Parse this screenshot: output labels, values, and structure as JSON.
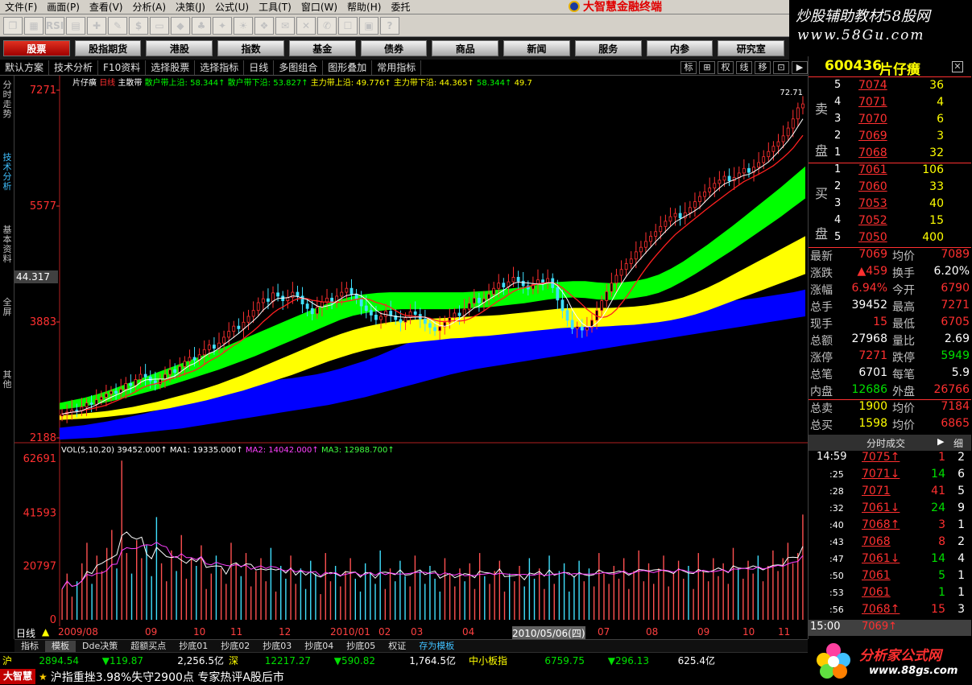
{
  "menu": [
    "文件(F)",
    "画面(P)",
    "查看(V)",
    "分析(A)",
    "决策(J)",
    "公式(U)",
    "工具(T)",
    "窗口(W)",
    "帮助(H)",
    "委托"
  ],
  "brand": {
    "title": "大智慧金融终端",
    "corner_text": "炒股辅助教材58股网",
    "corner_url": "www.58Gu.com"
  },
  "toolbar": [
    "❐",
    "▦",
    "RSI",
    "▤",
    "✚",
    "✎",
    "$",
    "▭",
    "◆",
    "♣",
    "✦",
    "☀",
    "❖",
    "✉",
    "✕",
    "✆",
    "☐",
    "▣",
    "?"
  ],
  "nav": [
    "股票",
    "股指期货",
    "港股",
    "指数",
    "基金",
    "债券",
    "商品",
    "新闻",
    "服务",
    "内参",
    "研究室"
  ],
  "subbar": [
    "默认方案",
    "技术分析",
    "F10资料",
    "选择股票",
    "选择指标",
    "日线",
    "多图组合",
    "图形叠加",
    "常用指标"
  ],
  "subbar_right": [
    "标",
    "⊞",
    "权",
    "线",
    "移",
    "⊡",
    "▶"
  ],
  "sidebar": [
    "分时走势",
    "技术分析",
    "基本资料",
    "全屏",
    "其他"
  ],
  "chart": {
    "stock_name": "片仔癀",
    "period": "日线",
    "indicator_name": "主散带",
    "legend": [
      {
        "label": "散户带上沿",
        "value": "58.344↑",
        "color": "#00ff00"
      },
      {
        "label": "散户带下沿",
        "value": "53.827↑",
        "color": "#00ff00"
      },
      {
        "label": "主力带上沿",
        "value": "49.776↑",
        "color": "#ffff00"
      },
      {
        "label": "主力带下沿",
        "value": "44.365↑",
        "color": "#ffff00"
      },
      {
        "label": "",
        "value": "58.344↑",
        "color": "#00ff00"
      },
      {
        "label": "",
        "value": "49.7",
        "color": "#ffff00"
      }
    ],
    "top_label": "72.71",
    "yticks": [
      {
        "v": "72.71",
        "y": 18
      },
      {
        "v": "55.77",
        "y": 162
      },
      {
        "v": "38.83",
        "y": 306
      },
      {
        "v": "21.88",
        "y": 450
      }
    ],
    "ytick_labels": [
      "7271",
      "5577",
      "3883",
      "2188"
    ],
    "current_price_label": "44.317",
    "vol_header": {
      "name": "VOL(5,10,20)",
      "vol": "39452.000↑",
      "ma1": "MA1: 19335.000↑",
      "ma2": "MA2: 14042.000↑",
      "ma3": "MA3: 12988.700↑"
    },
    "vol_ticks": [
      "62691",
      "41593",
      "20797",
      "0"
    ],
    "period_label": "日线",
    "x_labels": [
      {
        "t": "2009/08",
        "x": 54
      },
      {
        "t": "09",
        "x": 162
      },
      {
        "t": "10",
        "x": 222
      },
      {
        "t": "11",
        "x": 268
      },
      {
        "t": "12",
        "x": 328
      },
      {
        "t": "2010/01",
        "x": 392
      },
      {
        "t": "02",
        "x": 452
      },
      {
        "t": "03",
        "x": 492
      },
      {
        "t": "04",
        "x": 556
      },
      {
        "t": "2010/05/06(四)",
        "x": 618
      },
      {
        "t": "07",
        "x": 724
      },
      {
        "t": "08",
        "x": 784
      },
      {
        "t": "09",
        "x": 848
      },
      {
        "t": "10",
        "x": 904
      },
      {
        "t": "11",
        "x": 948
      }
    ],
    "price_series": [
      22.5,
      22.8,
      23.1,
      23.0,
      23.6,
      24.2,
      24.0,
      24.7,
      25.1,
      25.6,
      26.0,
      25.7,
      26.3,
      27.2,
      26.9,
      27.8,
      28.6,
      28.2,
      27.6,
      27.1,
      27.9,
      28.6,
      29.3,
      28.9,
      29.8,
      30.6,
      31.2,
      30.8,
      31.6,
      32.4,
      33.1,
      32.6,
      33.4,
      34.3,
      35.2,
      36.0,
      35.6,
      36.6,
      37.5,
      38.4,
      39.6,
      40.2,
      39.8,
      41.1,
      40.6,
      39.9,
      40.4,
      41.2,
      40.6,
      39.4,
      38.7,
      37.9,
      38.9,
      39.7,
      40.3,
      39.6,
      40.6,
      41.2,
      41.8,
      40.9,
      40.2,
      39.1,
      38.4,
      37.7,
      37.0,
      37.5,
      38.3,
      37.6,
      37.0,
      36.6,
      37.3,
      38.2,
      37.8,
      37.1,
      36.4,
      35.8,
      35.3,
      35.9,
      36.6,
      37.3,
      38.0,
      37.6,
      38.6,
      39.5,
      40.3,
      39.6,
      40.2,
      40.9,
      41.8,
      42.6,
      42.0,
      42.8,
      43.5,
      42.9,
      42.2,
      41.7,
      42.4,
      43.1,
      42.7,
      43.3,
      41.9,
      40.0,
      38.4,
      36.9,
      35.6,
      35.9,
      35.4,
      35.8,
      36.9,
      38.4,
      39.9,
      41.3,
      42.6,
      43.8,
      44.7,
      45.6,
      46.3,
      47.4,
      48.1,
      49.0,
      49.8,
      50.5,
      51.3,
      52.1,
      52.8,
      53.3,
      52.6,
      53.4,
      54.2,
      55.1,
      55.9,
      56.6,
      57.2,
      57.9,
      58.4,
      59.0,
      58.3,
      58.8,
      59.5,
      60.2,
      59.6,
      60.4,
      61.1,
      62.0,
      62.8,
      63.6,
      64.3,
      65.2,
      66.4,
      67.8,
      69.5,
      70.1
    ],
    "band_green_top": [
      24.2,
      24.6,
      25.0,
      25.5,
      26.1,
      26.8,
      27.5,
      28.2,
      28.9,
      29.6,
      30.3,
      31.0,
      31.7,
      32.4,
      33.2,
      34.0,
      34.8,
      35.6,
      36.4,
      37.2,
      38.0,
      38.8,
      39.5,
      40.1,
      40.6,
      40.9,
      41.1,
      41.2,
      41.2,
      41.2,
      41.2,
      41.2,
      41.2,
      41.2,
      41.3,
      41.4,
      41.6,
      41.8,
      42.0,
      42.3,
      42.6,
      42.8,
      42.9,
      42.9,
      42.7,
      42.6,
      42.7,
      42.9,
      43.3,
      43.9,
      44.8,
      45.9,
      47.2,
      48.5,
      49.9,
      51.3,
      52.8,
      54.3,
      55.8,
      57.3,
      58.9,
      60.5
    ],
    "band_green_bot": [
      23.2,
      23.4,
      23.7,
      24.0,
      24.4,
      24.8,
      25.3,
      25.8,
      26.3,
      26.9,
      27.5,
      28.1,
      28.7,
      29.3,
      30.0,
      30.7,
      31.4,
      32.2,
      33.0,
      33.8,
      34.6,
      35.4,
      36.2,
      37.0,
      37.6,
      38.0,
      38.3,
      38.5,
      38.6,
      38.6,
      38.6,
      38.6,
      38.6,
      38.7,
      38.8,
      38.9,
      39.1,
      39.3,
      39.5,
      39.8,
      40.1,
      40.3,
      40.4,
      40.3,
      40.1,
      40.0,
      40.1,
      40.3,
      40.6,
      41.1,
      41.9,
      42.9,
      44.0,
      45.2,
      46.4,
      47.6,
      48.9,
      50.2,
      51.5,
      52.8,
      54.2,
      55.6
    ],
    "band_yellow_top": [
      22.3,
      22.4,
      22.6,
      22.8,
      23.0,
      23.3,
      23.6,
      24.0,
      24.4,
      24.9,
      25.4,
      25.9,
      26.5,
      27.1,
      27.8,
      28.5,
      29.3,
      30.1,
      30.9,
      31.7,
      32.5,
      33.3,
      34.1,
      34.8,
      35.4,
      35.9,
      36.3,
      36.6,
      36.8,
      37.0,
      37.1,
      37.2,
      37.3,
      37.4,
      37.5,
      37.6,
      37.7,
      37.9,
      38.1,
      38.3,
      38.5,
      38.7,
      38.8,
      38.8,
      38.8,
      38.8,
      38.9,
      39.0,
      39.2,
      39.5,
      39.9,
      40.4,
      41.1,
      41.9,
      42.8,
      43.8,
      44.8,
      45.8,
      46.8,
      47.8,
      48.8,
      49.8
    ],
    "band_yellow_bot": [
      21.6,
      21.7,
      21.8,
      21.9,
      22.1,
      22.3,
      22.5,
      22.8,
      23.1,
      23.4,
      23.8,
      24.2,
      24.6,
      25.1,
      25.6,
      26.1,
      26.7,
      27.3,
      27.9,
      28.5,
      29.2,
      29.9,
      30.6,
      31.2,
      31.8,
      32.3,
      32.7,
      33.0,
      33.3,
      33.5,
      33.7,
      33.9,
      34.1,
      34.2,
      34.4,
      34.5,
      34.7,
      34.9,
      35.1,
      35.3,
      35.5,
      35.7,
      35.8,
      35.9,
      35.9,
      36.0,
      36.1,
      36.2,
      36.4,
      36.6,
      36.9,
      37.3,
      37.8,
      38.4,
      39.1,
      39.8,
      40.5,
      41.2,
      41.9,
      42.6,
      43.3,
      44.0
    ],
    "band_blue_top": [
      20.4,
      20.6,
      20.8,
      21.1,
      21.4,
      21.8,
      22.2,
      22.6,
      23.1,
      23.6,
      24.1,
      24.6,
      25.1,
      25.7,
      26.3,
      26.8,
      27.2,
      27.5,
      27.8,
      28.0,
      28.3,
      28.6,
      29.0,
      29.5,
      30.1,
      30.7,
      31.4,
      32.2,
      33.0,
      33.8,
      34.5,
      35.0,
      35.4,
      35.6,
      35.8,
      36.0,
      36.2,
      36.4,
      36.5,
      36.7,
      36.9,
      37.1,
      37.3,
      37.5,
      37.7,
      37.9,
      38.1,
      38.3,
      38.5,
      38.7,
      38.9,
      39.1,
      39.3,
      39.5,
      39.7,
      39.9,
      40.1,
      40.3,
      40.6,
      40.9,
      41.2,
      41.6
    ],
    "band_blue_bot": [
      18.6,
      18.7,
      18.8,
      18.9,
      19.1,
      19.3,
      19.5,
      19.7,
      19.9,
      20.1,
      20.3,
      20.6,
      20.9,
      21.2,
      21.5,
      21.8,
      22.1,
      22.4,
      22.7,
      23.0,
      23.3,
      23.6,
      23.9,
      24.3,
      24.7,
      25.1,
      25.6,
      26.1,
      26.6,
      27.1,
      27.6,
      28.1,
      28.6,
      29.0,
      29.4,
      29.7,
      30.0,
      30.3,
      30.6,
      30.9,
      31.2,
      31.5,
      31.8,
      32.1,
      32.4,
      32.7,
      33.0,
      33.3,
      33.6,
      33.9,
      34.2,
      34.5,
      34.8,
      35.1,
      35.4,
      35.7,
      36.0,
      36.3,
      36.6,
      36.9,
      37.2,
      37.5
    ],
    "volumes": [
      12,
      18,
      9,
      15,
      22,
      30,
      14,
      25,
      19,
      28,
      35,
      20,
      62,
      26,
      18,
      31,
      24,
      29,
      17,
      40,
      22,
      15,
      27,
      19,
      33,
      16,
      24,
      21,
      29,
      12,
      18,
      25,
      20,
      14,
      30,
      22,
      17,
      26,
      13,
      19,
      24,
      15,
      28,
      11,
      21,
      16,
      25,
      14,
      20,
      12,
      23,
      18,
      10,
      26,
      15,
      21,
      13,
      19,
      24,
      16,
      11,
      22,
      18,
      14,
      27,
      12,
      20,
      15,
      23,
      17,
      13,
      25,
      19,
      14,
      21,
      16,
      11,
      24,
      18,
      13,
      20,
      15,
      22,
      12,
      26,
      17,
      14,
      19,
      23,
      11,
      18,
      15,
      21,
      13,
      24,
      16,
      20,
      12,
      25,
      14,
      19,
      22,
      11,
      17,
      23,
      15,
      20,
      13,
      26,
      18,
      14,
      21,
      16,
      24,
      12,
      19,
      27,
      15,
      22,
      14,
      20,
      25,
      13,
      18,
      23,
      16,
      21,
      12,
      26,
      19,
      15,
      24,
      17,
      22,
      14,
      28,
      20,
      16,
      23,
      18,
      25,
      15,
      21,
      27,
      19,
      24,
      30,
      22,
      26,
      41
    ]
  },
  "quote": {
    "code": "600436",
    "name": "片仔癀",
    "sell": [
      {
        "lvl": "5",
        "p": "7074",
        "v": "36"
      },
      {
        "lvl": "4",
        "p": "7071",
        "v": "4"
      },
      {
        "lvl": "3",
        "p": "7070",
        "v": "6"
      },
      {
        "lvl": "2",
        "p": "7069",
        "v": "3"
      },
      {
        "lvl": "1",
        "p": "7068",
        "v": "32"
      }
    ],
    "buy": [
      {
        "lvl": "1",
        "p": "7061",
        "v": "106"
      },
      {
        "lvl": "2",
        "p": "7060",
        "v": "33"
      },
      {
        "lvl": "3",
        "p": "7053",
        "v": "40"
      },
      {
        "lvl": "4",
        "p": "7052",
        "v": "15"
      },
      {
        "lvl": "5",
        "p": "7050",
        "v": "400"
      }
    ],
    "sell_label": "卖盘",
    "buy_label": "买盘",
    "stats": [
      {
        "l1": "最新",
        "v1": "7069",
        "c1": "red",
        "l2": "均价",
        "v2": "7089",
        "c2": "red"
      },
      {
        "l1": "涨跌",
        "v1": "▲459",
        "c1": "red",
        "l2": "换手",
        "v2": "6.20%",
        "c2": "wht"
      },
      {
        "l1": "涨幅",
        "v1": "6.94%",
        "c1": "red",
        "l2": "今开",
        "v2": "6790",
        "c2": "red"
      },
      {
        "l1": "总手",
        "v1": "39452",
        "c1": "wht",
        "l2": "最高",
        "v2": "7271",
        "c2": "red"
      },
      {
        "l1": "现手",
        "v1": "15",
        "c1": "red",
        "l2": "最低",
        "v2": "6705",
        "c2": "red"
      },
      {
        "l1": "总额",
        "v1": "27968",
        "c1": "wht",
        "l2": "量比",
        "v2": "2.69",
        "c2": "wht"
      },
      {
        "l1": "涨停",
        "v1": "7271",
        "c1": "red",
        "l2": "跌停",
        "v2": "5949",
        "c2": "grn"
      },
      {
        "l1": "总笔",
        "v1": "6701",
        "c1": "wht",
        "l2": "每笔",
        "v2": "5.9",
        "c2": "wht"
      },
      {
        "l1": "内盘",
        "v1": "12686",
        "c1": "grn",
        "l2": "外盘",
        "v2": "26766",
        "c2": "red"
      },
      {
        "l1": "总卖",
        "v1": "1900",
        "c1": "ylw",
        "l2": "均价",
        "v2": "7184",
        "c2": "red"
      },
      {
        "l1": "总买",
        "v1": "1598",
        "c1": "ylw",
        "l2": "均价",
        "v2": "6865",
        "c2": "red"
      }
    ],
    "ticks_header": "分时成交",
    "ticks_header_right": "细",
    "ticks": [
      {
        "t": "14:59",
        "p": "7075↑",
        "v": "1",
        "n": "2",
        "c": "red"
      },
      {
        "t": ":25",
        "p": "7071↓",
        "v": "14",
        "n": "6",
        "c": "grn"
      },
      {
        "t": ":28",
        "p": "7071",
        "v": "41",
        "n": "5",
        "c": "red"
      },
      {
        "t": ":32",
        "p": "7061↓",
        "v": "24",
        "n": "9",
        "c": "grn"
      },
      {
        "t": ":40",
        "p": "7068↑",
        "v": "3",
        "n": "1",
        "c": "red"
      },
      {
        "t": ":43",
        "p": "7068",
        "v": "8",
        "n": "2",
        "c": "red"
      },
      {
        "t": ":47",
        "p": "7061↓",
        "v": "14",
        "n": "4",
        "c": "grn"
      },
      {
        "t": ":50",
        "p": "7061",
        "v": "5",
        "n": "1",
        "c": "grn"
      },
      {
        "t": ":53",
        "p": "7061",
        "v": "1",
        "n": "1",
        "c": "grn"
      },
      {
        "t": ":56",
        "p": "7068↑",
        "v": "15",
        "n": "3",
        "c": "red"
      }
    ],
    "close_time": "15:00",
    "close_price": "7069↑"
  },
  "tabs": [
    "指标",
    "模板",
    "Dde决策",
    "超额买点",
    "抄底01",
    "抄底02",
    "抄底03",
    "抄底04",
    "抄底05",
    "权证",
    "存为模板"
  ],
  "status": {
    "sh_label": "沪",
    "sh_idx": "2894.54",
    "sh_chg": "▼119.87",
    "sh_amt": "2,256.5亿",
    "sz_label": "深",
    "sz_idx": "12217.27",
    "sz_chg": "▼590.82",
    "sz_amt": "1,764.5亿",
    "sme_label": "中小板指",
    "sme_idx": "6759.75",
    "sme_chg": "▼296.13",
    "sme_amt": "625.4亿"
  },
  "news": {
    "brand": "大智慧",
    "star": "★",
    "text": "沪指重挫3.98%失守2900点 专家热评A股后市"
  },
  "ad": {
    "title": "分析家公式网",
    "url": "www.88gs.com"
  },
  "colors": {
    "green": "#00ff00",
    "yellow": "#ffff00",
    "blue": "#0000ff",
    "red": "#ff3030",
    "cyan": "#40e0ff"
  }
}
